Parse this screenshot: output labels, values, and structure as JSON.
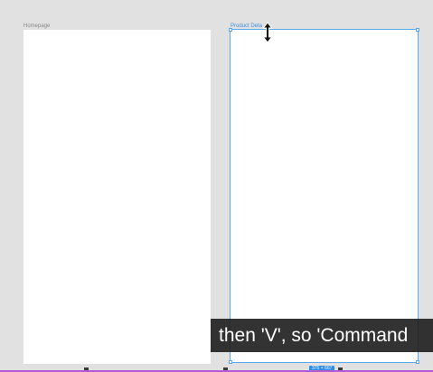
{
  "artboards": {
    "homepage": {
      "label": "Homepage"
    },
    "product_detail": {
      "label": "Product Deta",
      "selected": true,
      "size_label": "375 × 667"
    }
  },
  "caption": {
    "text": "then 'V', so 'Command"
  },
  "colors": {
    "canvas": "#e1e1e1",
    "artboard": "#ffffff",
    "selection": "#59a8f0",
    "label_selected": "#3d8fe0",
    "badge": "#2f8ce8"
  },
  "icons": {
    "cursor": "resize-vertical-cursor-icon"
  }
}
